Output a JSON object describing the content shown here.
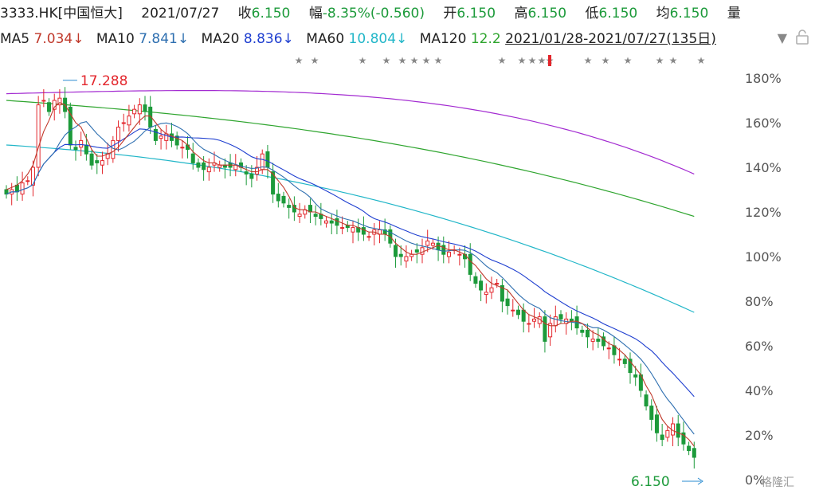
{
  "header": {
    "code": "3333.HK[中国恒大]",
    "date": "2021/07/27",
    "close_label": "收",
    "close_value": "6.150",
    "change_label": "幅",
    "change_value": "-8.35%(-0.560)",
    "open_label": "开",
    "open_value": "6.150",
    "high_label": "高",
    "high_value": "6.150",
    "low_label": "低",
    "low_value": "6.150",
    "avg_label": "均",
    "avg_value": "6.150",
    "vol_label": "量"
  },
  "ma_bar": {
    "ma5_label": "MA5",
    "ma5_value": "7.034↓",
    "ma10_label": "MA10",
    "ma10_value": "7.841↓",
    "ma20_label": "MA20",
    "ma20_value": "8.836↓",
    "ma60_label": "MA60",
    "ma60_value": "10.804↓",
    "ma120_label": "MA120",
    "ma120_value": "12.2",
    "range_text": "2021/01/28-2021/07/27(135日)",
    "dropdown_icon": "triangle-down-icon",
    "lock_icon": "lock-icon"
  },
  "colors": {
    "up": "#e3262c",
    "down": "#1c9a3a",
    "ma5": "#c0392b",
    "ma10": "#2e4fd8",
    "ma20": "#1f3fd0",
    "ma60": "#21b6c8",
    "ma120": "#2fa52f",
    "ma250": "#a32bd1",
    "axis_text": "#555555",
    "grid": "#eeeeee"
  },
  "annotations": {
    "high_marker": "17.288",
    "last_marker": "6.150"
  },
  "watermark": "格隆汇",
  "chart_data": {
    "type": "candlestick",
    "title": "",
    "y_axis": {
      "unit": "%",
      "range": [
        0,
        185
      ],
      "ticks": [
        "0%",
        "20%",
        "40%",
        "60%",
        "80%",
        "100%",
        "120%",
        "140%",
        "160%",
        "180%"
      ]
    },
    "x_range": [
      "2021/01/28",
      "2021/07/27"
    ],
    "grid": false,
    "candles_close": [
      128,
      130,
      129,
      133,
      134,
      140,
      168,
      170,
      165,
      170,
      171,
      165,
      150,
      148,
      152,
      146,
      141,
      142,
      143,
      146,
      152,
      158,
      160,
      163,
      166,
      168,
      165,
      158,
      152,
      154,
      155,
      152,
      150,
      149,
      148,
      142,
      140,
      139,
      140,
      142,
      141,
      140,
      140,
      141,
      140,
      137,
      135,
      140,
      146,
      140,
      128,
      125,
      124,
      122,
      120,
      119,
      121,
      120,
      118,
      117,
      116,
      115,
      114,
      113,
      113,
      113,
      111,
      110,
      109,
      112,
      112,
      110,
      106,
      100,
      100,
      100,
      101,
      102,
      104,
      107,
      106,
      103,
      101,
      102,
      103,
      101,
      99,
      92,
      88,
      85,
      84,
      86,
      88,
      80,
      78,
      76,
      74,
      71,
      70,
      72,
      73,
      62,
      70,
      73,
      72,
      72,
      71,
      68,
      66,
      64,
      63,
      62,
      60,
      59,
      56,
      54,
      52,
      48,
      46,
      40,
      33,
      27,
      21,
      18,
      22,
      25,
      19,
      16,
      13,
      10
    ],
    "ma5": [
      130,
      131,
      132,
      134,
      137,
      141,
      149,
      156,
      161,
      167,
      169,
      168,
      164,
      160,
      158,
      153,
      148,
      145,
      145,
      146,
      147,
      149,
      152,
      155,
      158,
      161,
      163,
      163,
      160,
      157,
      155,
      154,
      153,
      152,
      150,
      147,
      145,
      143,
      142,
      142,
      141,
      141,
      141,
      141,
      140,
      139,
      138,
      138,
      139,
      139,
      137,
      134,
      131,
      127,
      122,
      121,
      121,
      120,
      120,
      119,
      118,
      117,
      116,
      115,
      114,
      114,
      113,
      112,
      111,
      111,
      110,
      110,
      109,
      106,
      104,
      102,
      101,
      101,
      102,
      103,
      104,
      105,
      104,
      103,
      103,
      102,
      101,
      98,
      96,
      93,
      90,
      88,
      87,
      86,
      85,
      82,
      79,
      76,
      74,
      73,
      72,
      70,
      69,
      69,
      70,
      70,
      71,
      71,
      70,
      68,
      66,
      65,
      63,
      61,
      60,
      58,
      56,
      53,
      50,
      47,
      42,
      38,
      32,
      27,
      24,
      22,
      21,
      20,
      18,
      15
    ]
  }
}
